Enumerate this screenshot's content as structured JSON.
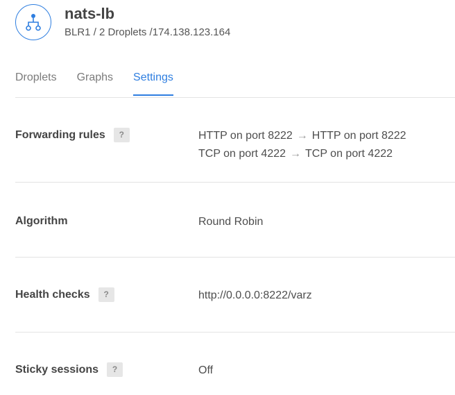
{
  "header": {
    "icon": "load-balancer-icon",
    "title": "nats-lb",
    "subtitle": "BLR1 / 2 Droplets /174.138.123.164",
    "accent_color": "#2e7ee0"
  },
  "tabs": [
    {
      "label": "Droplets",
      "active": false
    },
    {
      "label": "Graphs",
      "active": false
    },
    {
      "label": "Settings",
      "active": true
    }
  ],
  "settings": {
    "forwarding_rules": {
      "label": "Forwarding rules",
      "help": "?",
      "rules": [
        {
          "from": "HTTP on port 8222",
          "arrow": "→",
          "to": "HTTP on port 8222"
        },
        {
          "from": "TCP on port 4222",
          "arrow": "→",
          "to": "TCP on port 4222"
        }
      ]
    },
    "algorithm": {
      "label": "Algorithm",
      "value": "Round Robin"
    },
    "health_checks": {
      "label": "Health checks",
      "help": "?",
      "value": "http://0.0.0.0:8222/varz"
    },
    "sticky_sessions": {
      "label": "Sticky sessions",
      "help": "?",
      "value": "Off"
    }
  }
}
